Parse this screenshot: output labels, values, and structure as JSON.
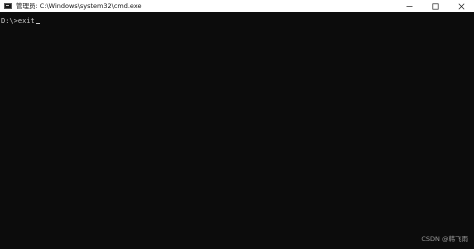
{
  "window": {
    "title": "管理员: C:\\Windows\\system32\\cmd.exe",
    "icon": "cmd-console-icon",
    "controls": {
      "minimize_icon": "minimize-icon",
      "maximize_icon": "maximize-icon",
      "close_icon": "close-icon"
    }
  },
  "console": {
    "lines": [
      {
        "text": "D:\\>exit"
      }
    ],
    "foreground": "#cccccc",
    "background": "#0c0c0c"
  },
  "watermark": {
    "text": "CSDN @韩飞雨"
  }
}
